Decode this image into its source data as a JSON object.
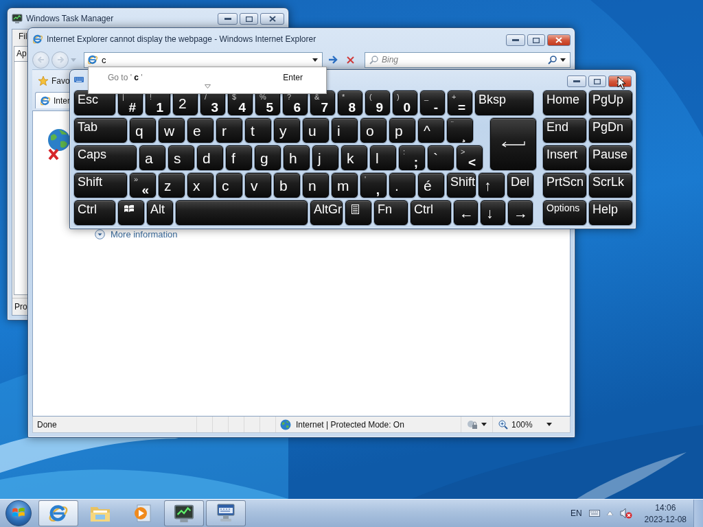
{
  "task_manager": {
    "title": "Windows Task Manager",
    "menu": [
      "Fil"
    ],
    "tabs": [
      {
        "label": "Ap",
        "selected": true
      }
    ],
    "status": "Pro"
  },
  "browser": {
    "title": "Internet Explorer cannot display the webpage - Windows Internet Explorer",
    "back": {
      "disabled": true
    },
    "forward": {
      "disabled": true
    },
    "address": "c",
    "suggestion": {
      "text": "Go to ' **c** '",
      "hint": "Enter"
    },
    "search": {
      "placeholder": "Bing"
    },
    "favorites": "Favo",
    "tabs": [
      {
        "label": "Inter",
        "selected": true
      }
    ],
    "more_info": "More information",
    "status": {
      "text": "Done",
      "zone": "Internet | Protected Mode: On",
      "zoom": "100%"
    }
  },
  "keyboard": {
    "main_rows": [
      [
        {
          "kind": "text",
          "label": "Esc"
        },
        {
          "kind": "text",
          "label": "#",
          "shift": "|"
        },
        {
          "kind": "text",
          "label": "1",
          "shift": "!"
        },
        {
          "kind": "text",
          "label": "2"
        },
        {
          "kind": "text",
          "label": "3",
          "shift": "/"
        },
        {
          "kind": "text",
          "label": "4",
          "shift": "$"
        },
        {
          "kind": "text",
          "label": "5",
          "shift": "%"
        },
        {
          "kind": "text",
          "label": "6",
          "shift": "?"
        },
        {
          "kind": "text",
          "label": "7",
          "shift": "&"
        },
        {
          "kind": "text",
          "label": "8",
          "shift": "*"
        },
        {
          "kind": "text",
          "label": "9",
          "shift": "("
        },
        {
          "kind": "text",
          "label": "0",
          "shift": ")"
        },
        {
          "kind": "text",
          "label": "-",
          "shift": "_"
        },
        {
          "kind": "text",
          "label": "=",
          "shift": "+"
        },
        {
          "kind": "text",
          "label": "Bksp"
        }
      ],
      [
        {
          "kind": "text",
          "label": "Tab"
        },
        {
          "kind": "text",
          "label": "q"
        },
        {
          "kind": "text",
          "label": "w"
        },
        {
          "kind": "text",
          "label": "e"
        },
        {
          "kind": "text",
          "label": "r"
        },
        {
          "kind": "text",
          "label": "t"
        },
        {
          "kind": "text",
          "label": "y"
        },
        {
          "kind": "text",
          "label": "u"
        },
        {
          "kind": "text",
          "label": "i"
        },
        {
          "kind": "text",
          "label": "o"
        },
        {
          "kind": "text",
          "label": "p"
        },
        {
          "kind": "text",
          "label": "^"
        },
        {
          "kind": "text",
          "label": "¸",
          "shift": "¨"
        },
        {
          "kind": "enter"
        }
      ],
      [
        {
          "kind": "text",
          "label": "Caps"
        },
        {
          "kind": "text",
          "label": "a"
        },
        {
          "kind": "text",
          "label": "s"
        },
        {
          "kind": "text",
          "label": "d"
        },
        {
          "kind": "text",
          "label": "f"
        },
        {
          "kind": "text",
          "label": "g"
        },
        {
          "kind": "text",
          "label": "h"
        },
        {
          "kind": "text",
          "label": "j"
        },
        {
          "kind": "text",
          "label": "k"
        },
        {
          "kind": "text",
          "label": "l"
        },
        {
          "kind": "text",
          "label": ";",
          "shift": ":"
        },
        {
          "kind": "text",
          "label": "`"
        },
        {
          "kind": "text",
          "label": "<",
          "shift": ">"
        }
      ],
      [
        {
          "kind": "text",
          "label": "Shift"
        },
        {
          "kind": "text",
          "label": "«",
          "shift": "»"
        },
        {
          "kind": "text",
          "label": "z"
        },
        {
          "kind": "text",
          "label": "x"
        },
        {
          "kind": "text",
          "label": "c"
        },
        {
          "kind": "text",
          "label": "v"
        },
        {
          "kind": "text",
          "label": "b"
        },
        {
          "kind": "text",
          "label": "n"
        },
        {
          "kind": "text",
          "label": "m"
        },
        {
          "kind": "text",
          "label": ",",
          "shift": "'"
        },
        {
          "kind": "text",
          "label": "."
        },
        {
          "kind": "text",
          "label": "é"
        },
        {
          "kind": "text",
          "label": "Shift"
        },
        {
          "kind": "text",
          "label": "↑"
        },
        {
          "kind": "text",
          "label": "Del"
        }
      ],
      [
        {
          "kind": "text",
          "label": "Ctrl"
        },
        {
          "kind": "windows"
        },
        {
          "kind": "text",
          "label": "Alt"
        },
        {
          "kind": "space"
        },
        {
          "kind": "text",
          "label": "AltGr"
        },
        {
          "kind": "menu"
        },
        {
          "kind": "text",
          "label": "Fn"
        },
        {
          "kind": "text",
          "label": "Ctrl"
        },
        {
          "kind": "text",
          "label": "←"
        },
        {
          "kind": "text",
          "label": "↓"
        },
        {
          "kind": "text",
          "label": "→"
        }
      ]
    ],
    "side_rows": [
      [
        "Home",
        "PgUp"
      ],
      [
        "End",
        "PgDn"
      ],
      [
        "Insert",
        "Pause"
      ],
      [
        "PrtScn",
        "ScrLk"
      ],
      [
        "Options",
        "Help"
      ]
    ]
  },
  "taskbar": {
    "items": [
      {
        "kind": "browser",
        "running": true,
        "selected": true
      },
      {
        "kind": "folder",
        "running": false,
        "selected": false
      },
      {
        "kind": "media",
        "running": false,
        "selected": false
      },
      {
        "kind": "monitor",
        "running": true,
        "selected": false
      },
      {
        "kind": "keyboard",
        "running": true,
        "selected": false
      }
    ],
    "language": "EN",
    "time": "14:06",
    "date": "2023-12-08"
  }
}
